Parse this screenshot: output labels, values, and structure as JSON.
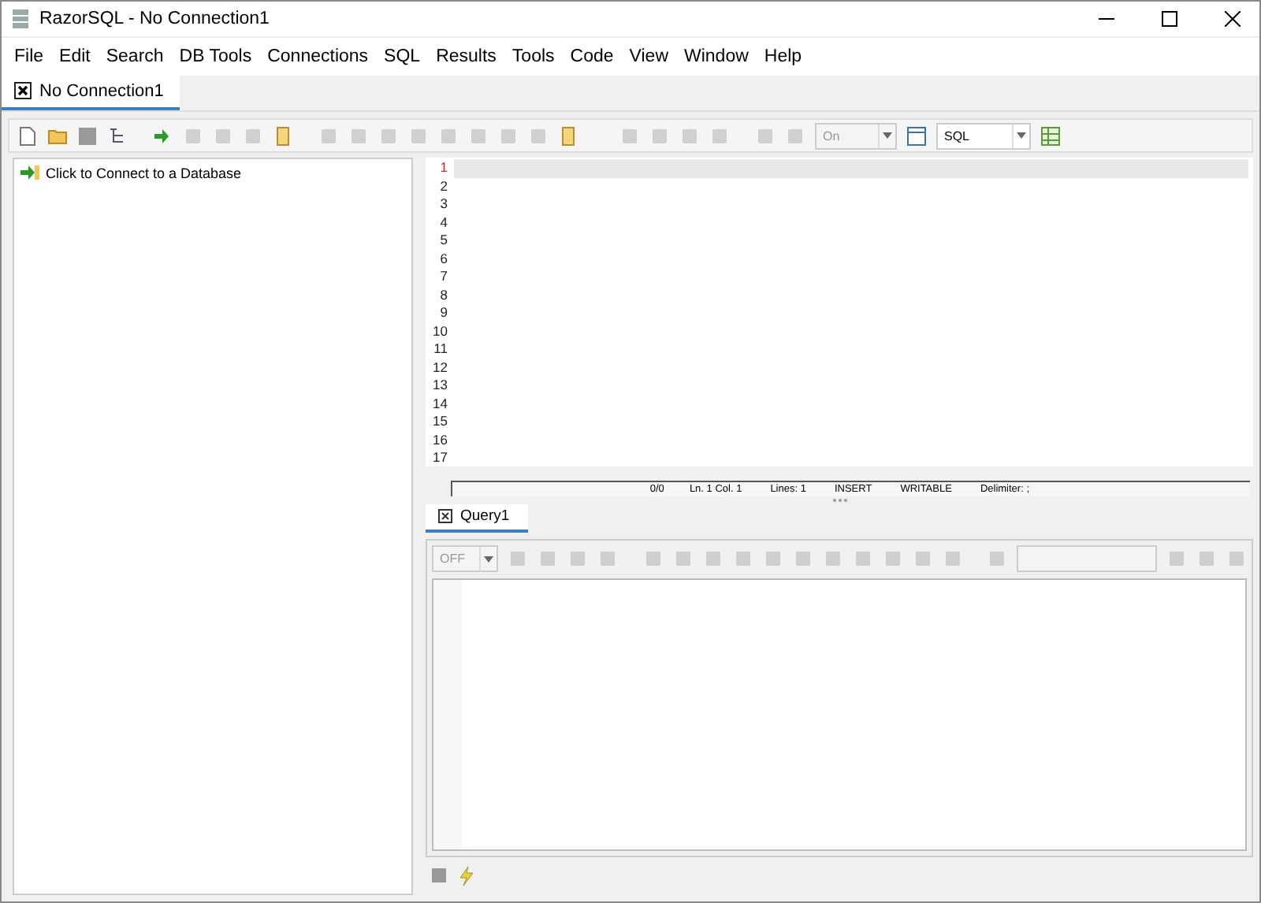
{
  "window": {
    "title": "RazorSQL - No Connection1"
  },
  "menu": [
    "File",
    "Edit",
    "Search",
    "DB Tools",
    "Connections",
    "SQL",
    "Results",
    "Tools",
    "Code",
    "View",
    "Window",
    "Help"
  ],
  "tabs": [
    {
      "label": "No Connection1",
      "selected": true
    }
  ],
  "toolbar": {
    "dropdowns": [
      {
        "value": "On"
      },
      {
        "value": "SQL"
      }
    ]
  },
  "sidebar": {
    "items": [
      {
        "label": "Click to Connect to a Database"
      }
    ]
  },
  "editor": {
    "lines": [
      {
        "number": "1",
        "current": true
      },
      {
        "number": "2",
        "current": false
      },
      {
        "number": "3",
        "current": false
      },
      {
        "number": "4",
        "current": false
      },
      {
        "number": "5",
        "current": false
      },
      {
        "number": "6",
        "current": false
      },
      {
        "number": "7",
        "current": false
      },
      {
        "number": "8",
        "current": false
      },
      {
        "number": "9",
        "current": false
      },
      {
        "number": "10",
        "current": false
      },
      {
        "number": "11",
        "current": false
      },
      {
        "number": "12",
        "current": false
      },
      {
        "number": "13",
        "current": false
      },
      {
        "number": "14",
        "current": false
      },
      {
        "number": "15",
        "current": false
      },
      {
        "number": "16",
        "current": false
      },
      {
        "number": "17",
        "current": false
      }
    ],
    "status": [
      "0/0",
      "Ln. 1 Col. 1",
      "Lines: 1",
      "INSERT",
      "WRITABLE",
      "Delimiter: ;"
    ]
  },
  "results": {
    "tabs": [
      {
        "label": "Query1",
        "selected": true
      }
    ],
    "dropdown": {
      "value": "OFF"
    }
  }
}
